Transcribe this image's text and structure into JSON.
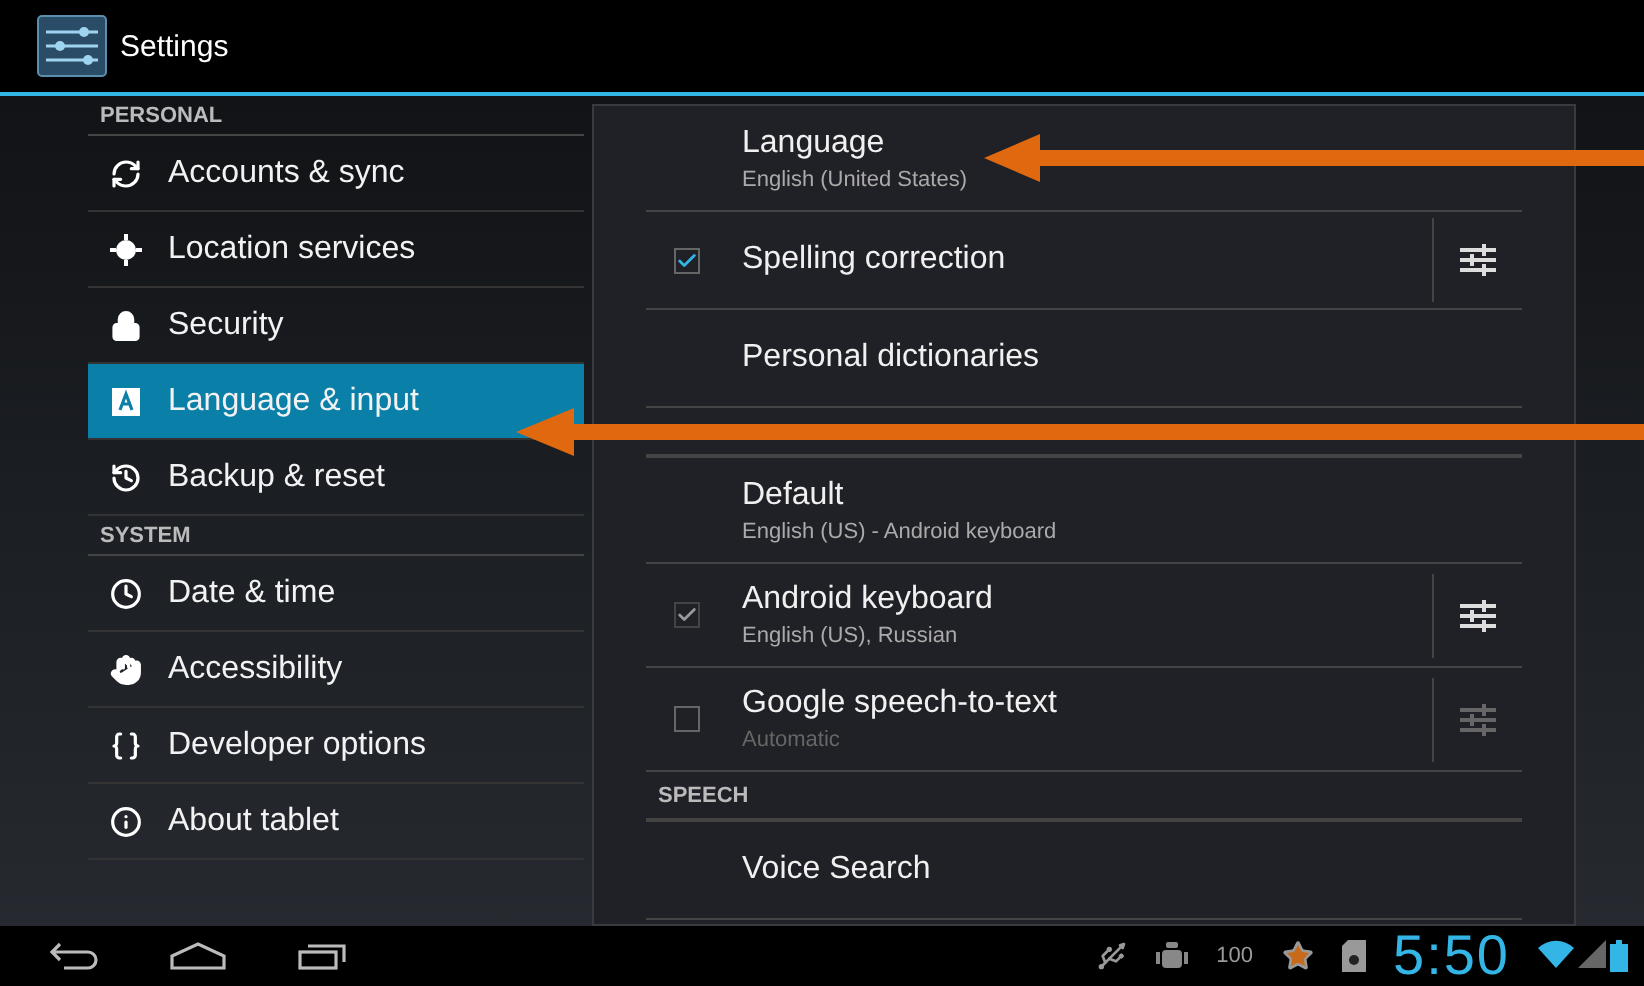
{
  "action_bar": {
    "title": "Settings"
  },
  "sidebar": {
    "sections": [
      {
        "header": "PERSONAL",
        "items": [
          {
            "label": "Accounts & sync",
            "selected": false
          },
          {
            "label": "Location services",
            "selected": false
          },
          {
            "label": "Security",
            "selected": false
          },
          {
            "label": "Language & input",
            "selected": true
          },
          {
            "label": "Backup & reset",
            "selected": false
          }
        ]
      },
      {
        "header": "SYSTEM",
        "items": [
          {
            "label": "Date & time",
            "selected": false
          },
          {
            "label": "Accessibility",
            "selected": false
          },
          {
            "label": "Developer options",
            "selected": false
          },
          {
            "label": "About tablet",
            "selected": false
          }
        ]
      }
    ]
  },
  "panel": {
    "rows": [
      {
        "kind": "item",
        "title": "Language",
        "summary": "English (United States)"
      },
      {
        "kind": "checkbox",
        "title": "Spelling correction",
        "checked": true,
        "checkbox_disabled": false,
        "settings_disabled": false
      },
      {
        "kind": "item",
        "title": "Personal dictionaries"
      },
      {
        "kind": "header"
      },
      {
        "kind": "item",
        "title": "Default",
        "summary": "English (US) - Android keyboard"
      },
      {
        "kind": "checkbox",
        "title": "Android keyboard",
        "summary": "English (US), Russian",
        "checked": true,
        "checkbox_disabled": true,
        "settings_disabled": false
      },
      {
        "kind": "checkbox",
        "title": "Google speech-to-text",
        "summary": "Automatic",
        "checked": false,
        "checkbox_disabled": false,
        "settings_disabled": true
      },
      {
        "kind": "header",
        "title": "SPEECH"
      },
      {
        "kind": "item",
        "title": "Voice Search"
      }
    ]
  },
  "status_bar": {
    "battery_percent": "100",
    "time": "5:50"
  }
}
